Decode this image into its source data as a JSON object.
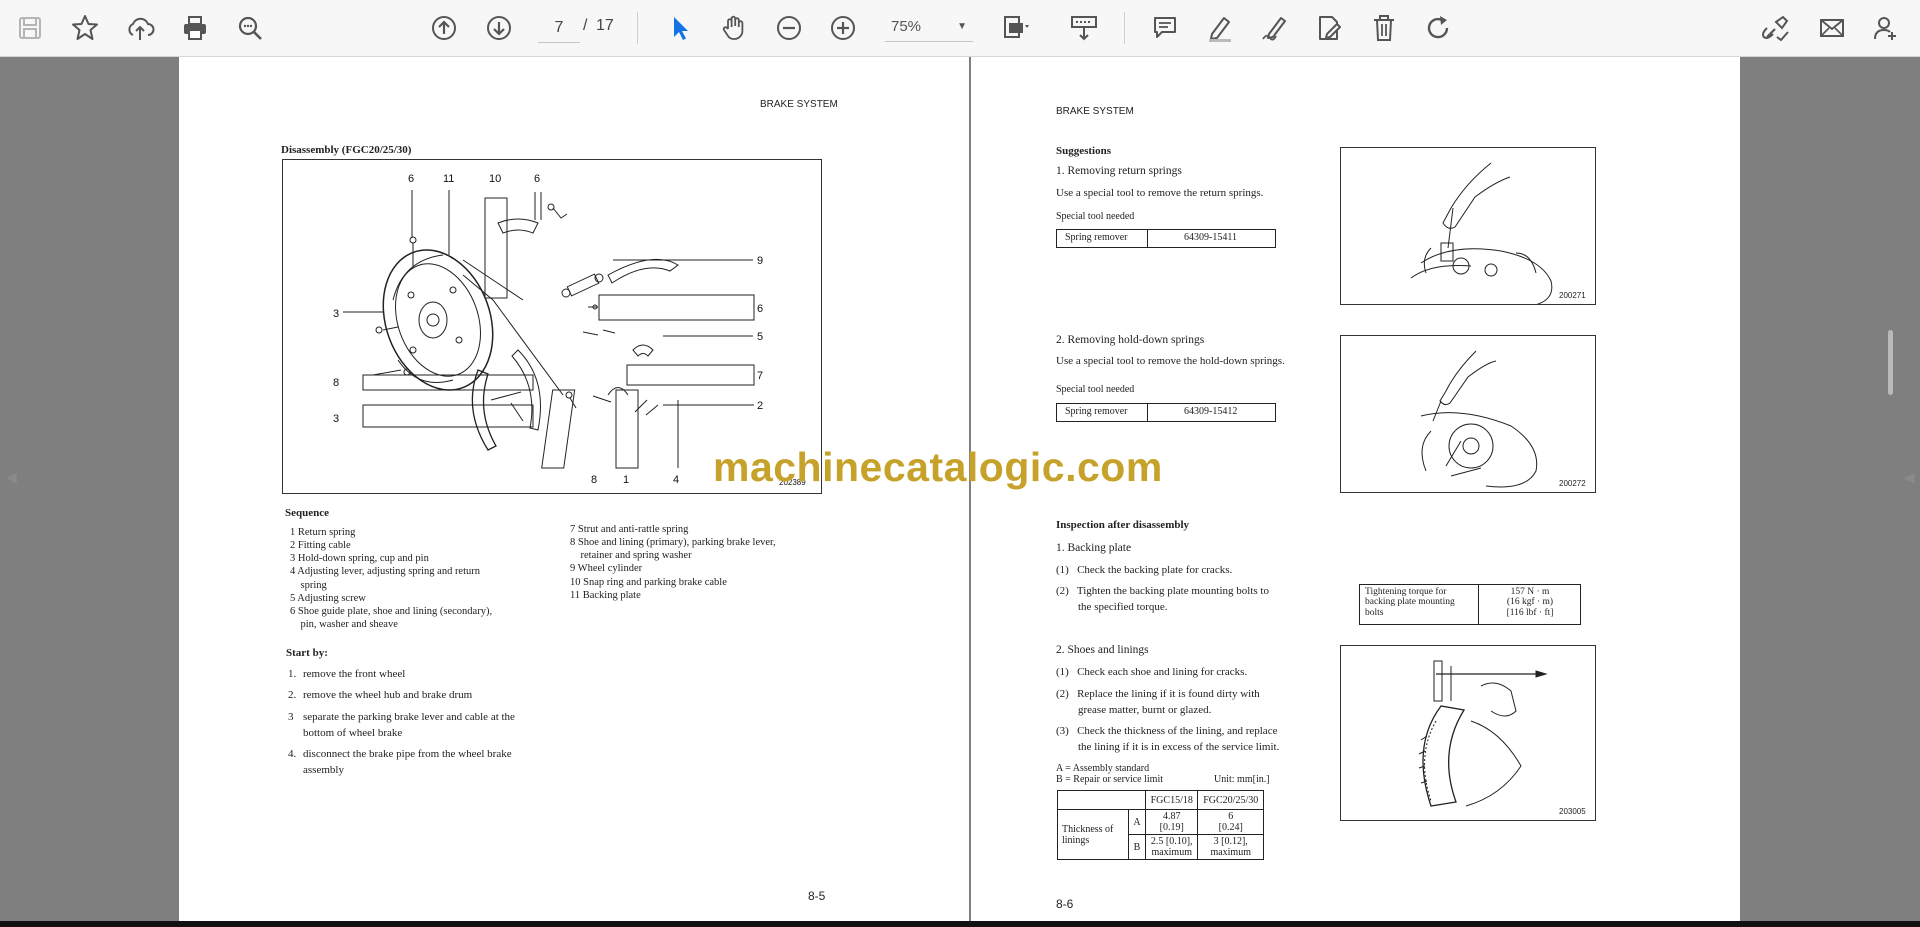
{
  "toolbar": {
    "current_page": "7",
    "page_separator": "/",
    "total_pages": "17",
    "zoom": "75%",
    "icons": [
      "save-icon",
      "bookmark-star-icon",
      "upload-icon",
      "print-icon",
      "zoom-search-icon",
      "page-up-icon",
      "page-down-icon",
      "select-cursor-icon",
      "hand-pan-icon",
      "zoom-out-icon",
      "zoom-in-icon",
      "page-fit-icon",
      "keyboard-icon",
      "comment-icon",
      "highlight-pen-icon",
      "sign-icon",
      "edit-doc-icon",
      "delete-icon",
      "redo-icon",
      "share-link-icon",
      "mail-icon",
      "add-user-icon"
    ]
  },
  "watermark": "machinecatalogic.com",
  "left_page": {
    "header": "BRAKE SYSTEM",
    "figure_title": "Disassembly (FGC20/25/30)",
    "callouts": [
      "6",
      "11",
      "10",
      "6",
      "9",
      "3",
      "6",
      "5",
      "8",
      "7",
      "2",
      "3",
      "8",
      "1",
      "4"
    ],
    "figure_code": "202389",
    "sequence_title": "Sequence",
    "sequence_left": [
      "1  Return spring",
      "2  Fitting cable",
      "3  Hold-down spring, cup and pin",
      "4  Adjusting lever, adjusting spring and return",
      "    spring",
      "5  Adjusting screw",
      "6  Shoe guide plate, shoe and lining (secondary),",
      "    pin, washer and sheave"
    ],
    "sequence_right": [
      "7  Strut and anti-rattle spring",
      "8  Shoe and lining (primary), parking brake lever,",
      "    retainer and spring washer",
      "9  Wheel cylinder",
      "10  Snap ring and parking brake cable",
      "11  Backing plate"
    ],
    "start_title": "Start by:",
    "start_items": [
      {
        "n": "1.",
        "t": "remove the front wheel"
      },
      {
        "n": "2.",
        "t": "remove the wheel hub and brake drum"
      },
      {
        "n": "3",
        "t": "separate the parking brake lever and cable at the"
      },
      {
        "n": "",
        "t": "bottom of wheel brake"
      },
      {
        "n": "4.",
        "t": "disconnect the brake pipe from the wheel brake"
      },
      {
        "n": "",
        "t": "assembly"
      }
    ],
    "page_number": "8-5"
  },
  "right_page": {
    "header": "BRAKE SYSTEM",
    "suggestions_title": "Suggestions",
    "s1_title": "1.  Removing return springs",
    "s1_text": "Use a special tool to remove the return springs.",
    "s1_tool_label": "Special tool needed",
    "s1_tool_name": "Spring remover",
    "s1_tool_part": "64309-15411",
    "s1_fig_code": "200271",
    "s2_title": "2.  Removing hold-down springs",
    "s2_text": "Use a special tool to remove the hold-down springs.",
    "s2_tool_label": "Special tool needed",
    "s2_tool_name": "Spring remover",
    "s2_tool_part": "64309-15412",
    "s2_fig_code": "200272",
    "insp_title": "Inspection after disassembly",
    "bp_title": "1.  Backing plate",
    "bp_1": "(1)   Check the backing plate for cracks.",
    "bp_2a": "(2)   Tighten the backing plate mounting bolts to",
    "bp_2b": "        the specified torque.",
    "torque_label": [
      "Tightening torque for",
      "backing plate mounting",
      "bolts"
    ],
    "torque_values": [
      "157 N · m",
      "(16 kgf · m)",
      "[116 lbf · ft]"
    ],
    "sl_title": "2.  Shoes and linings",
    "sl_1": "(1)   Check each shoe and lining for cracks.",
    "sl_2a": "(2)   Replace the lining if it is found dirty with",
    "sl_2b": "        grease matter, burnt or glazed.",
    "sl_3a": "(3)   Check the thickness of the lining, and replace",
    "sl_3b": "        the lining if it is in excess of the service limit.",
    "legend_a": "A = Assembly standard",
    "legend_b": "B = Repair or service limit",
    "unit": "Unit: mm[in.]",
    "table": {
      "col1": "FGC15/18",
      "col2": "FGC20/25/30",
      "row_label": [
        "Thickness of",
        "linings"
      ],
      "a_label": "A",
      "b_label": "B",
      "a1": [
        "4.87",
        "[0.19]"
      ],
      "a2": [
        "6",
        "[0.24]"
      ],
      "b1": [
        "2.5 [0.10],",
        "maximum"
      ],
      "b2": [
        "3 [0.12],",
        "maximum"
      ]
    },
    "s3_fig_code": "203005",
    "page_number": "8-6"
  }
}
